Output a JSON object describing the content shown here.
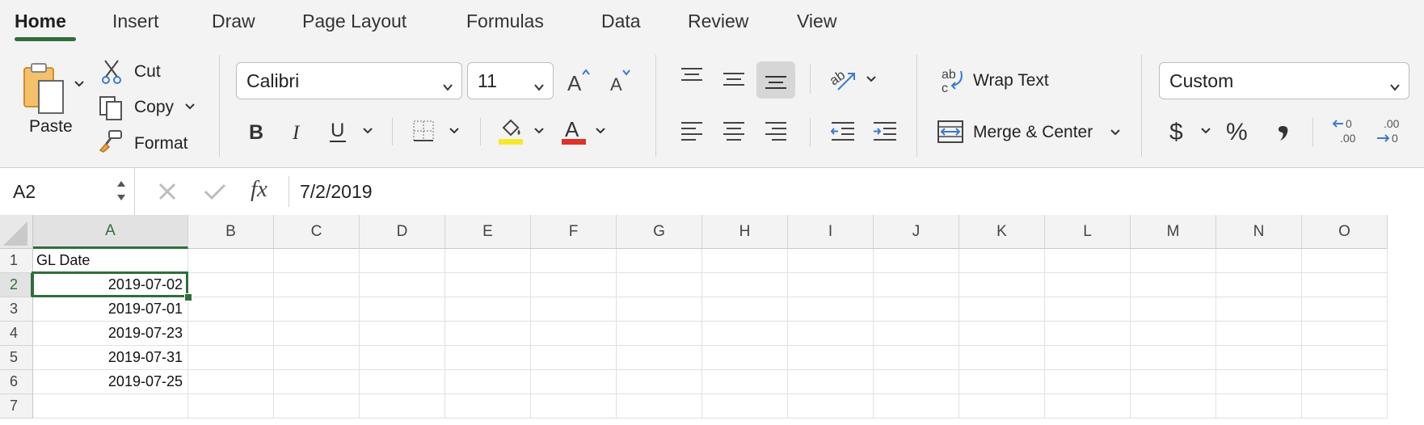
{
  "tabs": [
    {
      "label": "Home",
      "active": true
    },
    {
      "label": "Insert"
    },
    {
      "label": "Draw"
    },
    {
      "label": "Page Layout"
    },
    {
      "label": "Formulas"
    },
    {
      "label": "Data"
    },
    {
      "label": "Review"
    },
    {
      "label": "View"
    }
  ],
  "clipboard": {
    "paste": "Paste",
    "cut": "Cut",
    "copy": "Copy",
    "format": "Format"
  },
  "font": {
    "name": "Calibri",
    "size": "11",
    "fill_color": "#f5e92c",
    "font_color": "#e0302a"
  },
  "alignment": {
    "wrap_text": "Wrap Text",
    "merge_center": "Merge & Center"
  },
  "number": {
    "format": "Custom"
  },
  "formula_bar": {
    "name_box": "A2",
    "formula": "7/2/2019",
    "fx": "fx"
  },
  "sheet": {
    "columns": [
      "A",
      "B",
      "C",
      "D",
      "E",
      "F",
      "G",
      "H",
      "I",
      "J",
      "K",
      "L",
      "M",
      "N",
      "O"
    ],
    "selected_column": "A",
    "selected_row": "2",
    "rows": [
      {
        "num": "1",
        "a": "GL Date"
      },
      {
        "num": "2",
        "a": "2019-07-02"
      },
      {
        "num": "3",
        "a": "2019-07-01"
      },
      {
        "num": "4",
        "a": "2019-07-23"
      },
      {
        "num": "5",
        "a": "2019-07-31"
      },
      {
        "num": "6",
        "a": "2019-07-25"
      },
      {
        "num": "7",
        "a": ""
      }
    ]
  },
  "colors": {
    "accent": "#2f6f3a"
  }
}
